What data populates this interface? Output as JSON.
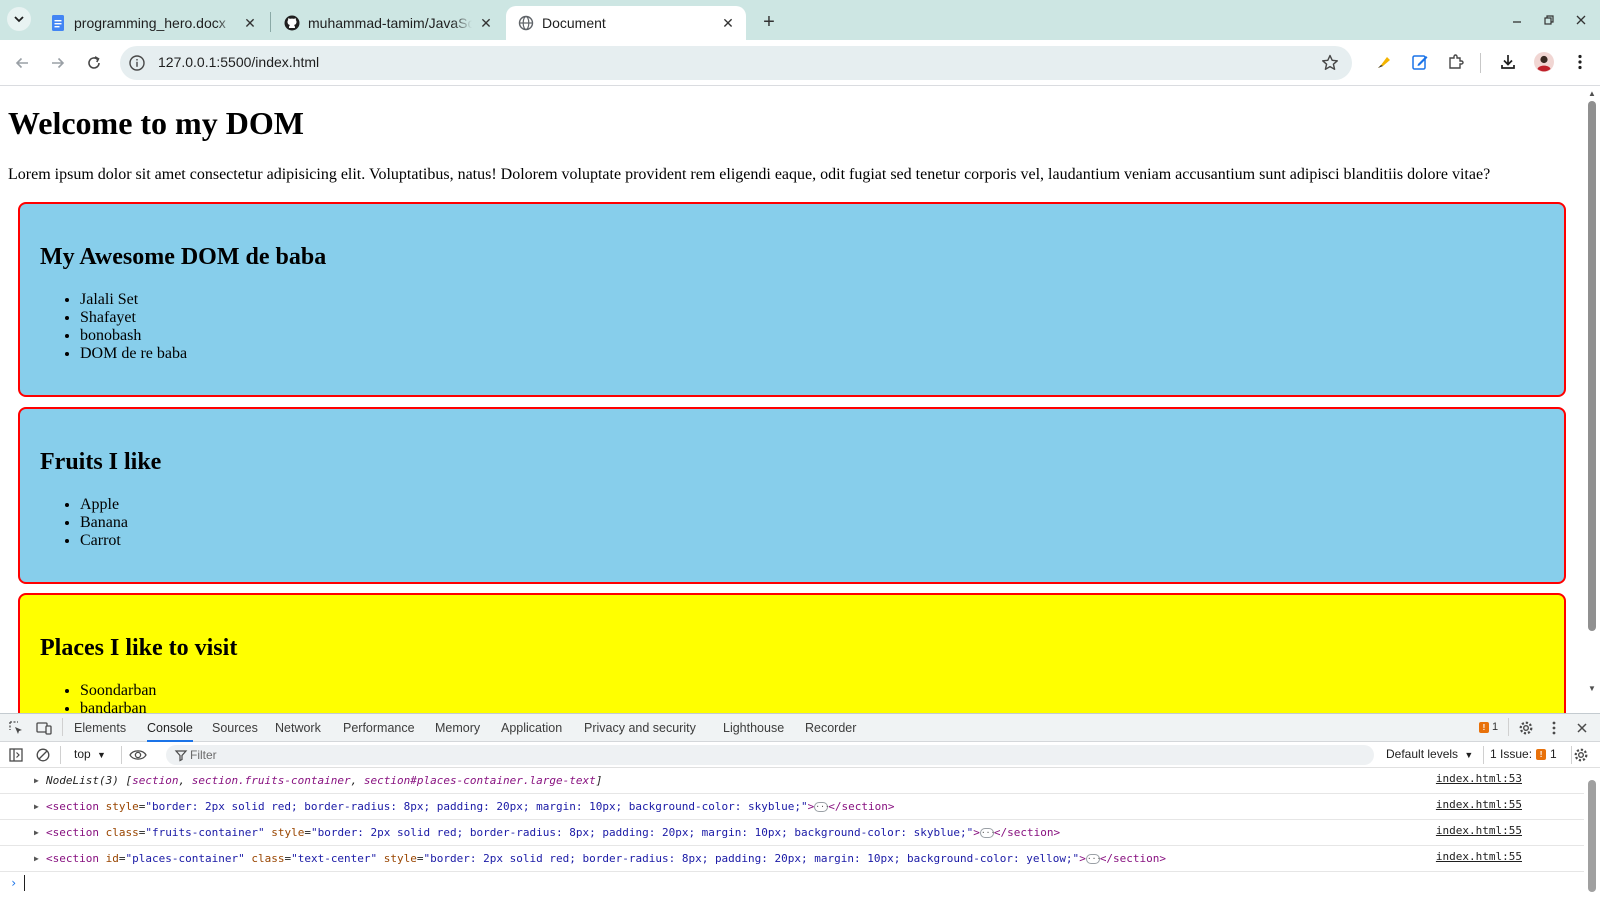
{
  "browser": {
    "tabs": [
      {
        "title": "programming_hero.docx",
        "icon": "docs-icon"
      },
      {
        "title": "muhammad-tamim/JavaScript",
        "icon": "github-icon"
      },
      {
        "title": "Document",
        "icon": "globe-icon"
      }
    ],
    "url": "127.0.0.1:5500/index.html"
  },
  "page": {
    "heading": "Welcome to my DOM",
    "paragraph": "Lorem ipsum dolor sit amet consectetur adipisicing elit. Voluptatibus, natus! Dolorem voluptate provident rem eligendi eaque, odit fugiat sed tenetur corporis vel, laudantium veniam accusantium sunt adipisci blanditiis dolore vitae?",
    "sections": [
      {
        "title": "My Awesome DOM de baba",
        "items": [
          "Jalali Set",
          "Shafayet",
          "bonobash",
          "DOM de re baba"
        ],
        "color": "#87ceeb"
      },
      {
        "title": "Fruits I like",
        "items": [
          "Apple",
          "Banana",
          "Carrot"
        ],
        "color": "#87ceeb"
      },
      {
        "title": "Places I like to visit",
        "items": [
          "Soondarban",
          "bandarban"
        ],
        "color": "#ffff00"
      }
    ]
  },
  "devtools": {
    "tabs": [
      "Elements",
      "Console",
      "Sources",
      "Network",
      "Performance",
      "Memory",
      "Application",
      "Privacy and security",
      "Lighthouse",
      "Recorder"
    ],
    "active_tab": "Console",
    "error_count": "1",
    "context": "top",
    "filter_placeholder": "Filter",
    "levels": "Default levels",
    "issues_label": "1 Issue:",
    "issues_count": "1",
    "console": {
      "nodelist_prefix": "NodeList(3) [",
      "nodelist_items": [
        "section",
        "section.fruits-container",
        "section#places-container.large-text"
      ],
      "nodelist_suffix": "]",
      "rows": [
        {
          "src": "index.html:53"
        },
        {
          "tag_open": "<section",
          "attrs": [
            {
              "name": "style",
              "value": "\"border: 2px solid red; border-radius: 8px; padding: 20px; margin: 10px; background-color: skyblue;\""
            }
          ],
          "tag_close": "</section>",
          "src": "index.html:55"
        },
        {
          "tag_open": "<section",
          "attrs": [
            {
              "name": "class",
              "value": "\"fruits-container\""
            },
            {
              "name": "style",
              "value": "\"border: 2px solid red; border-radius: 8px; padding: 20px; margin: 10px; background-color: skyblue;\""
            }
          ],
          "tag_close": "</section>",
          "src": "index.html:55"
        },
        {
          "tag_open": "<section",
          "attrs": [
            {
              "name": "id",
              "value": "\"places-container\""
            },
            {
              "name": "class",
              "value": "\"text-center\""
            },
            {
              "name": "style",
              "value": "\"border: 2px solid red; border-radius: 8px; padding: 20px; margin: 10px; background-color: yellow;\""
            }
          ],
          "tag_close": "</section>",
          "src": "index.html:55"
        }
      ]
    }
  }
}
